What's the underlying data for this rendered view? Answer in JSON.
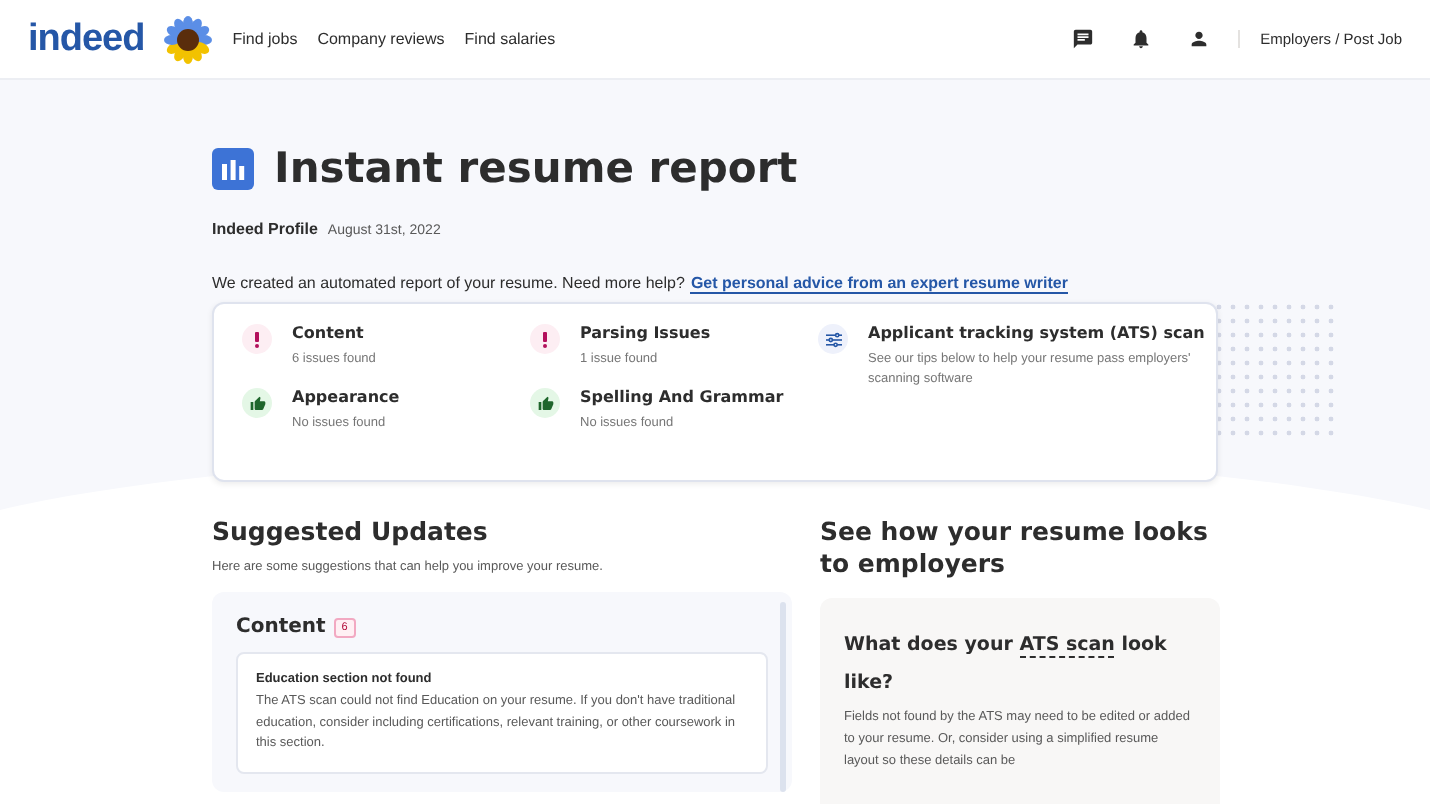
{
  "header": {
    "logo": "indeed",
    "nav": [
      "Find jobs",
      "Company reviews",
      "Find salaries"
    ],
    "employers_link": "Employers / Post Job"
  },
  "report": {
    "title": "Instant resume report",
    "source": "Indeed Profile",
    "date": "August 31st, 2022",
    "intro": "We created an automated report of your resume. Need more help?",
    "help_link": "Get personal advice from an expert resume writer"
  },
  "summary": [
    {
      "kind": "issue",
      "title": "Content",
      "detail": "6 issues found"
    },
    {
      "kind": "issue",
      "title": "Parsing Issues",
      "detail": "1 issue found"
    },
    {
      "kind": "info",
      "title": "Applicant tracking system (ATS) scan",
      "detail": "See our tips below to help your resume pass employers' scanning software"
    },
    {
      "kind": "ok",
      "title": "Appearance",
      "detail": "No issues found"
    },
    {
      "kind": "ok",
      "title": "Spelling And Grammar",
      "detail": "No issues found"
    }
  ],
  "suggested": {
    "title": "Suggested Updates",
    "subtitle": "Here are some suggestions that can help you improve your resume.",
    "section": "Content",
    "count": "6",
    "item_title": "Education section not found",
    "item_text": "The ATS scan could not find Education on your resume. If you don't have traditional education, consider including certifications, relevant training, or other coursework in this section."
  },
  "preview": {
    "title": "See how your resume looks to employers",
    "question_start": "What does your",
    "question_term": "ATS scan",
    "question_end": "look like?",
    "text": "Fields not found by the ATS may need to be edited or added to your resume. Or, consider using a simplified resume layout so these details can be"
  }
}
